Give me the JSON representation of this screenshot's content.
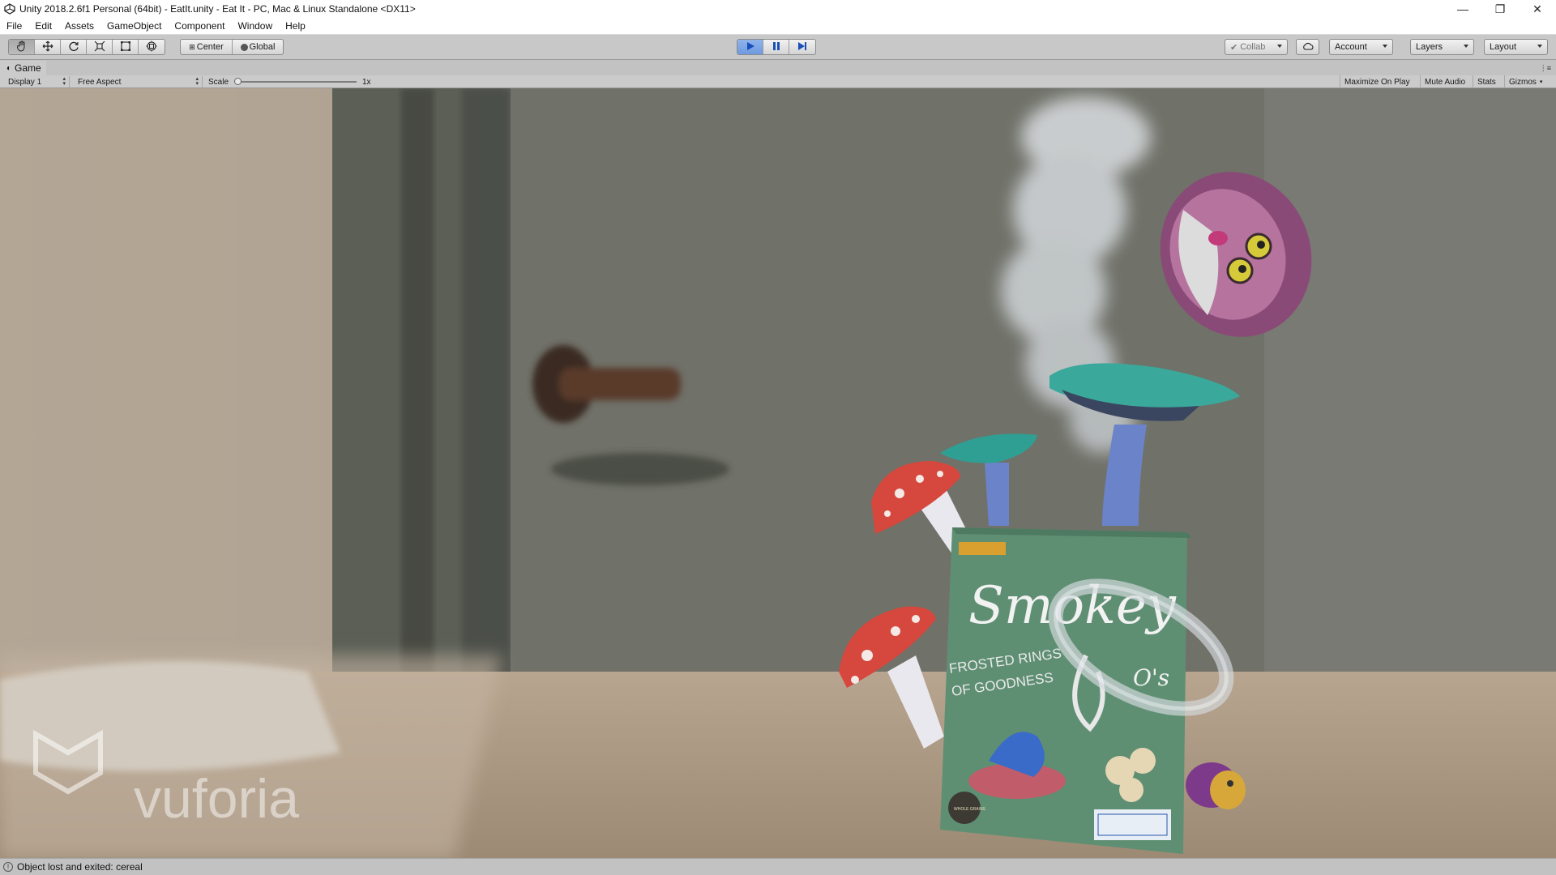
{
  "window": {
    "title": "Unity 2018.2.6f1 Personal (64bit) - EatIt.unity - Eat It - PC, Mac & Linux Standalone <DX11>",
    "minimize": "—",
    "maximize": "❐",
    "close": "✕"
  },
  "menubar": [
    "File",
    "Edit",
    "Assets",
    "GameObject",
    "Component",
    "Window",
    "Help"
  ],
  "toolbar": {
    "transform_tools": [
      "hand-tool",
      "move-tool",
      "rotate-tool",
      "scale-tool",
      "rect-tool",
      "transform-tool"
    ],
    "pivot_center": "Center",
    "pivot_global": "Global",
    "collab": "Collab",
    "account": "Account",
    "layers": "Layers",
    "layout": "Layout"
  },
  "game_panel": {
    "tab_label": "Game",
    "display": "Display 1",
    "aspect": "Free Aspect",
    "scale_label": "Scale",
    "scale_value": "1x",
    "scale_level": 0,
    "toggles": [
      "Maximize On Play",
      "Mute Audio",
      "Stats",
      "Gizmos"
    ]
  },
  "scene": {
    "watermark": "vuforia",
    "box_brand": "Smokey",
    "box_suffix": "O's",
    "box_tagline_1": "FROSTED RINGS",
    "box_tagline_2": "OF GOODNESS",
    "box_badge": "WHOLE GRAINS"
  },
  "status": {
    "message": "Object lost and exited: cereal"
  }
}
